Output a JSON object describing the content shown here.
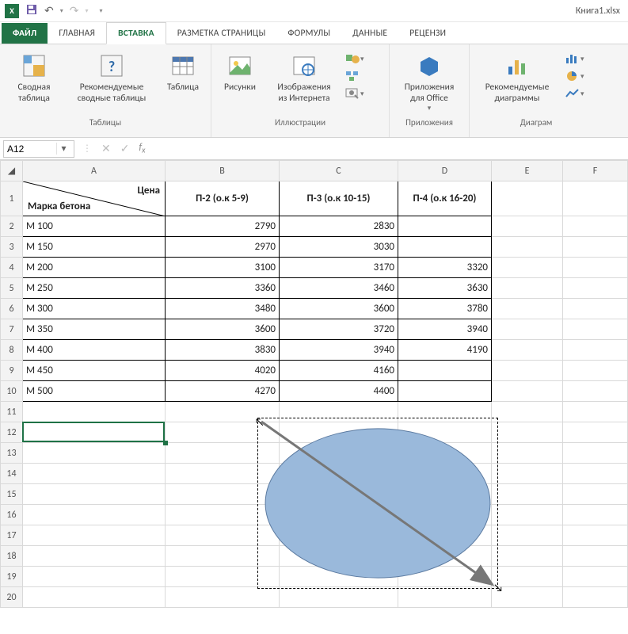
{
  "window": {
    "title": "Книга1.xlsx"
  },
  "qat": {
    "logo": "X",
    "save_icon": "floppy",
    "undo_icon": "undo",
    "redo_icon": "redo"
  },
  "tabs": {
    "file": "ФАЙЛ",
    "items": [
      {
        "label": "ГЛАВНАЯ"
      },
      {
        "label": "ВСТАВКА",
        "active": true
      },
      {
        "label": "РАЗМЕТКА СТРАНИЦЫ"
      },
      {
        "label": "ФОРМУЛЫ"
      },
      {
        "label": "ДАННЫЕ"
      },
      {
        "label": "РЕЦЕНЗИ"
      }
    ]
  },
  "ribbon": {
    "group_tables": {
      "label": "Таблицы",
      "pivot": "Сводная\nтаблица",
      "rec_pivot": "Рекомендуемые\nсводные таблицы",
      "table": "Таблица"
    },
    "group_illust": {
      "label": "Иллюстрации",
      "pictures": "Рисунки",
      "online_pics": "Изображения\nиз Интернета",
      "shapes_icon": "shapes",
      "smartart_icon": "smartart",
      "screenshot_icon": "screenshot"
    },
    "group_apps": {
      "label": "Приложения",
      "apps": "Приложения\nдля Office"
    },
    "group_charts": {
      "label": "Диаграм",
      "rec_charts": "Рекомендуемые\nдиаграммы"
    }
  },
  "formula_bar": {
    "name_box": "A12",
    "formula": ""
  },
  "columns": [
    "A",
    "B",
    "C",
    "D",
    "E",
    "F"
  ],
  "header": {
    "diag_top": "Цена",
    "diag_bottom": "Марка бетона",
    "c2": "П-2 (о.к 5-9)",
    "c3": "П-3 (о.к 10-15)",
    "c4": "П-4 (о.к 16-20)"
  },
  "rows": [
    {
      "n": 2,
      "a": "М 100",
      "b": "2790",
      "c": "2830",
      "d": ""
    },
    {
      "n": 3,
      "a": "М 150",
      "b": "2970",
      "c": "3030",
      "d": ""
    },
    {
      "n": 4,
      "a": "М 200",
      "b": "3100",
      "c": "3170",
      "d": "3320"
    },
    {
      "n": 5,
      "a": "М 250",
      "b": "3360",
      "c": "3460",
      "d": "3630"
    },
    {
      "n": 6,
      "a": "М 300",
      "b": "3480",
      "c": "3600",
      "d": "3780"
    },
    {
      "n": 7,
      "a": "М 350",
      "b": "3600",
      "c": "3720",
      "d": "3940"
    },
    {
      "n": 8,
      "a": "М 400",
      "b": "3830",
      "c": "3940",
      "d": "4190"
    },
    {
      "n": 9,
      "a": "М 450",
      "b": "4020",
      "c": "4160",
      "d": ""
    },
    {
      "n": 10,
      "a": "М 500",
      "b": "4270",
      "c": "4400",
      "d": ""
    }
  ],
  "blank_rows": [
    11,
    12,
    13,
    14,
    15,
    16,
    17,
    18,
    19,
    20
  ],
  "selected_cell": "A12",
  "shape": {
    "type": "ellipse",
    "fill": "#9ab9db",
    "stroke": "#5b7aa0"
  }
}
